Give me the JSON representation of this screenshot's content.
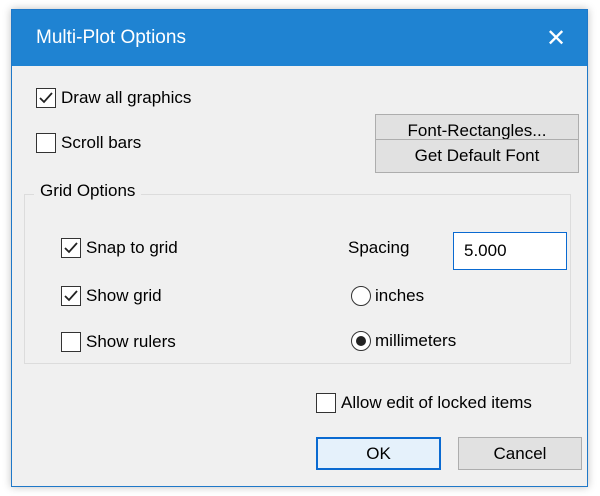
{
  "window": {
    "title": "Multi-Plot Options",
    "close_glyph": "✕"
  },
  "options": {
    "draw_all_graphics": {
      "label": "Draw all graphics",
      "checked": true
    },
    "scroll_bars": {
      "label": "Scroll bars",
      "checked": false
    }
  },
  "buttons": {
    "font_rectangles": "Font-Rectangles...",
    "get_default_font": "Get Default Font",
    "ok": "OK",
    "cancel": "Cancel"
  },
  "grid": {
    "title": "Grid Options",
    "snap_to_grid": {
      "label": "Snap to grid",
      "checked": true
    },
    "show_grid": {
      "label": "Show grid",
      "checked": true
    },
    "show_rulers": {
      "label": "Show rulers",
      "checked": false
    },
    "spacing_label": "Spacing",
    "spacing_value": "5.000",
    "units": [
      {
        "label": "inches",
        "selected": false
      },
      {
        "label": "millimeters",
        "selected": true
      }
    ]
  },
  "allow_edit_locked": {
    "label": "Allow edit of locked items",
    "checked": false
  },
  "colors": {
    "titlebar": "#1f83d2",
    "accent": "#0a6ad1",
    "dialog_bg": "#f0f0f0"
  }
}
